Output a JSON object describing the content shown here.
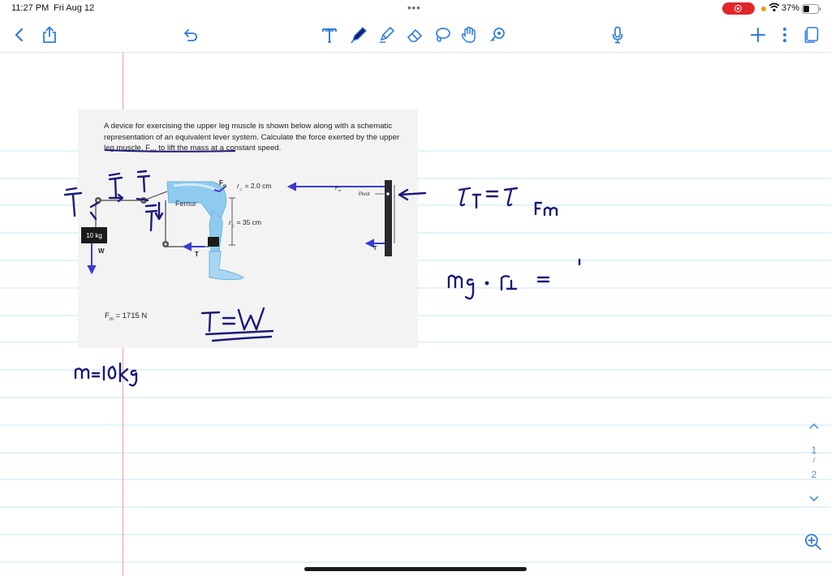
{
  "status_bar": {
    "time": "11:27 PM",
    "date": "Fri Aug 12",
    "more": "•••",
    "battery_percent": "37%"
  },
  "toolbar": {
    "icons": [
      "back-chevron-icon",
      "share-icon",
      "undo-icon",
      "text-tool-icon",
      "pen-icon",
      "highlighter-icon",
      "eraser-icon",
      "lasso-icon",
      "hand-tool-icon",
      "shape-tool-icon",
      "microphone-icon",
      "add-icon",
      "more-icon",
      "pages-icon"
    ]
  },
  "problem": {
    "text": "A device for exercising the upper leg muscle is shown below along with a schematic representation of an equivalent lever system. Calculate the force exerted by the upper leg muscle, F",
    "text_sub": "m",
    "text_tail": ", to lift the mass at a constant speed.",
    "mass_label": "10 kg",
    "w_label": "W",
    "t_label_left": "T",
    "t_label_right": "T",
    "femur_label": "Femur",
    "fm_label": "F",
    "fm_sub": "m",
    "r1_value": "= 2.0 cm",
    "r2_value": "= 35 cm",
    "pivot_label": "Pivot",
    "answer_label": "F",
    "answer_sub": "m",
    "answer_value": " = 1715 N"
  },
  "handwriting": {
    "torque_equation": "τT = τFm",
    "moment_equation": "mg · r⊥ =",
    "tension_equation": "T = W",
    "mass_note": "m = 10kg"
  },
  "page_nav": {
    "current": "1",
    "separator": "/",
    "total": "2"
  },
  "colors": {
    "ink": "#1a1a7a",
    "accent": "#2f7de1",
    "recording": "#e0262b",
    "margin": "#e9a0ac",
    "rule": "#c6e7f7"
  }
}
